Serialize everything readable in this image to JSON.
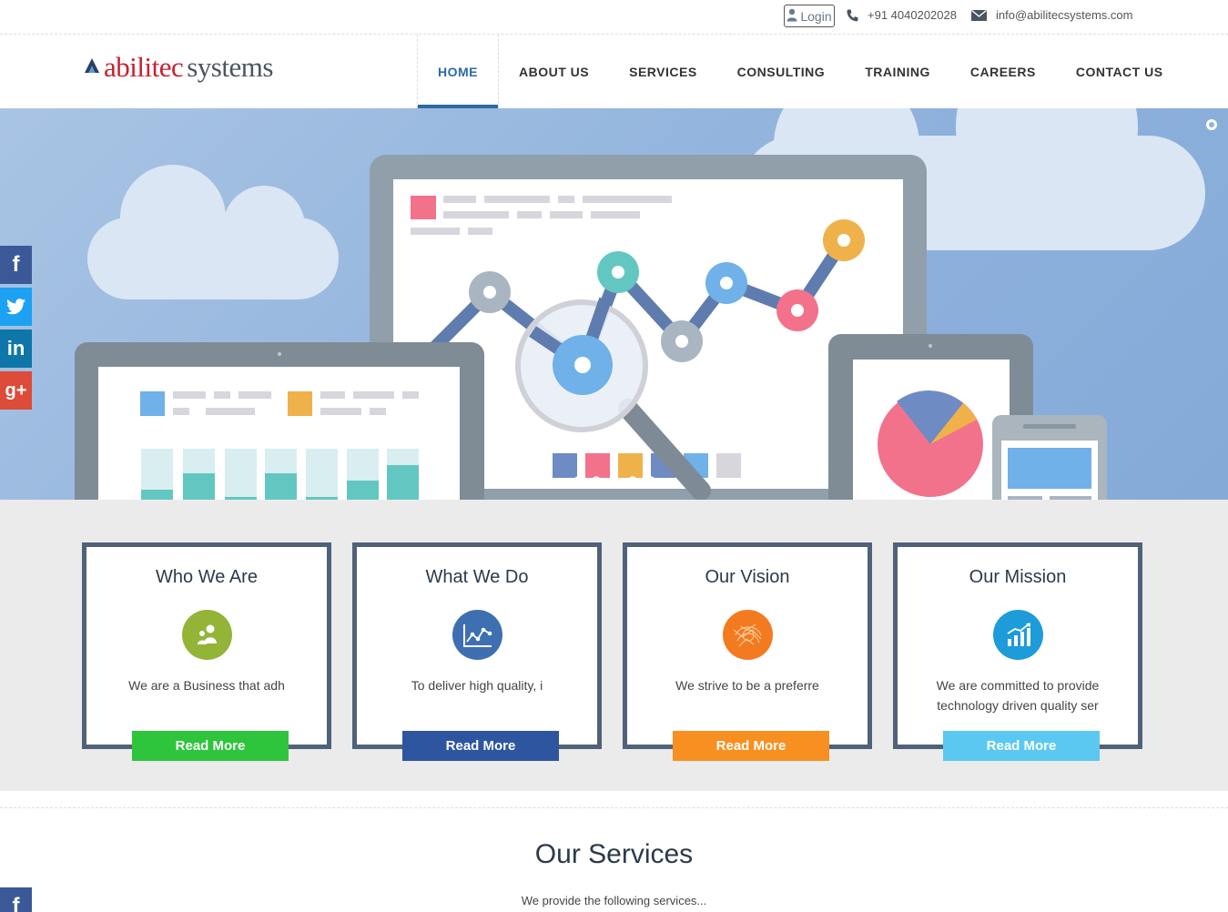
{
  "topbar": {
    "login_label": "Login",
    "phone": "+91 4040202028",
    "email": "info@abilitecsystems.com"
  },
  "logo": {
    "word1": "abilitec",
    "word2": "systems"
  },
  "nav": [
    {
      "label": "HOME",
      "active": true
    },
    {
      "label": "ABOUT US",
      "active": false
    },
    {
      "label": "SERVICES",
      "active": false
    },
    {
      "label": "CONSULTING",
      "active": false
    },
    {
      "label": "TRAINING",
      "active": false
    },
    {
      "label": "CAREERS",
      "active": false
    },
    {
      "label": "CONTACT US",
      "active": false
    }
  ],
  "social": [
    {
      "name": "facebook-icon",
      "glyph": "f"
    },
    {
      "name": "twitter-icon",
      "glyph": ""
    },
    {
      "name": "linkedin-icon",
      "glyph": "in"
    },
    {
      "name": "google-plus-icon",
      "glyph": "g+"
    }
  ],
  "cards": [
    {
      "title": "Who We Are",
      "text": "We are a Business that adh",
      "button": "Read More",
      "color": "#2ec53d",
      "icon_color": "#93b437",
      "icon": "people-icon"
    },
    {
      "title": "What We Do",
      "text": "To deliver high quality, i",
      "button": "Read More",
      "color": "#2e56a0",
      "icon_color": "#3e6fb0",
      "icon": "line-chart-icon"
    },
    {
      "title": "Our Vision",
      "text": "We strive to be a preferre",
      "button": "Read More",
      "color": "#f79021",
      "icon_color": "#f47a20",
      "icon": "vision-icon"
    },
    {
      "title": "Our Mission",
      "text": "We are committed to provide technology driven quality ser",
      "button": "Read More",
      "color": "#5bc8f2",
      "icon_color": "#1e9bd9",
      "icon": "bar-chart-icon"
    }
  ],
  "services": {
    "title": "Our Services",
    "subtitle": "We provide the following services..."
  }
}
